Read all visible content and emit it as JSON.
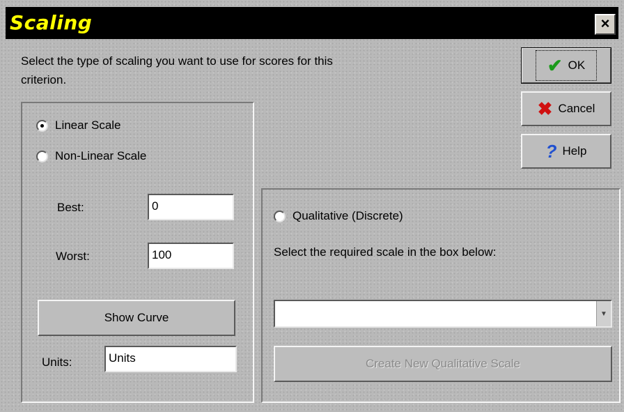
{
  "window": {
    "title": "Scaling"
  },
  "title_bar": {
    "close_label": "×"
  },
  "intro_text": "Select the type of scaling you want to use for scores for this criterion.",
  "buttons": {
    "ok": {
      "label": "OK",
      "icon": "checkmark-icon",
      "icon_color": "#1a9a1a"
    },
    "cancel": {
      "label": "Cancel",
      "icon": "x-icon",
      "icon_color": "#d01010"
    },
    "help": {
      "label": "Help",
      "icon": "question-icon",
      "icon_color": "#2050d0"
    }
  },
  "quantitative": {
    "options": [
      {
        "label": "Linear Scale",
        "checked": true
      },
      {
        "label": "Non-Linear Scale",
        "checked": false
      }
    ],
    "best": {
      "label": "Best:",
      "value": "0"
    },
    "worst": {
      "label": "Worst:",
      "value": "100"
    },
    "show_curve_label": "Show Curve",
    "units": {
      "label": "Units:",
      "value": "Units"
    }
  },
  "qualitative": {
    "option": {
      "label": "Qualitative (Discrete)",
      "checked": false
    },
    "instruction": "Select the required scale in the box below:",
    "select_value": "",
    "create_label": "Create New Qualitative Scale"
  }
}
